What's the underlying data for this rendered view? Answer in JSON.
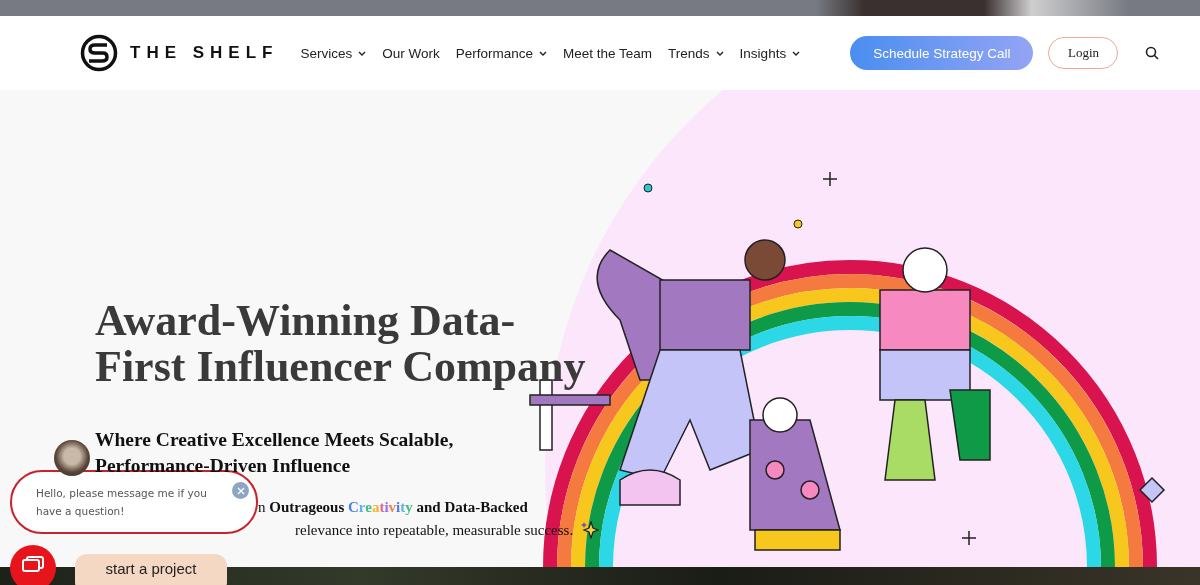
{
  "header": {
    "logo_text": "THE SHELF",
    "nav": [
      {
        "label": "Services",
        "has_menu": true
      },
      {
        "label": "Our Work",
        "has_menu": false
      },
      {
        "label": "Performance",
        "has_menu": true
      },
      {
        "label": "Meet the Team",
        "has_menu": false
      },
      {
        "label": "Trends",
        "has_menu": true
      },
      {
        "label": "Insights",
        "has_menu": true
      }
    ],
    "cta": "Schedule Strategy Call",
    "login": "Login"
  },
  "hero": {
    "title_lines": [
      "Award-Winning Data-",
      "First Influencer Company"
    ],
    "subtitle": "Where Creative Excellence Meets Scalable, Performance-Driven Influence",
    "body_lines": [
      {
        "before": "n **Outrageous** ",
        "highlight": "Creativity",
        "after": " **and Data-Backed**"
      },
      {
        "before": "relevance into repeatable, measurable success."
      }
    ],
    "button": "start a project"
  },
  "chat": {
    "message": "Hello, please message me if you have a question!"
  }
}
